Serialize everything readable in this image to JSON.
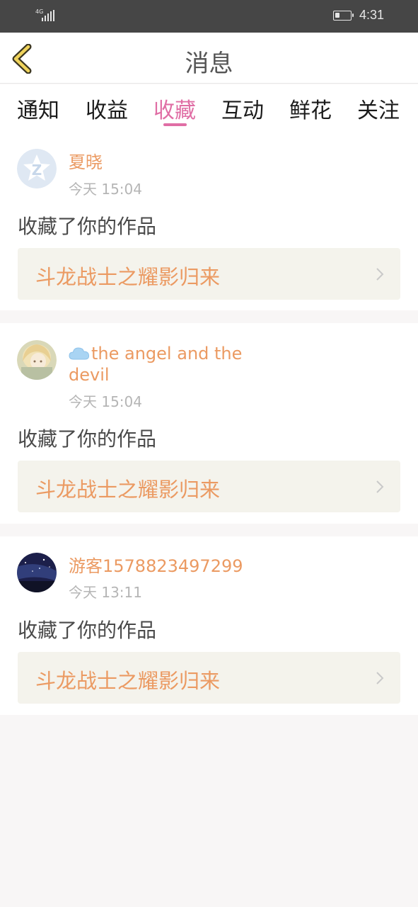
{
  "status_bar": {
    "network": "4G",
    "time": "4:31",
    "battery_level": 0.3
  },
  "nav": {
    "title": "消息",
    "back_icon": "chevron-left-icon"
  },
  "tabs": [
    {
      "label": "通知",
      "active": false
    },
    {
      "label": "收益",
      "active": false
    },
    {
      "label": "收藏",
      "active": true
    },
    {
      "label": "互动",
      "active": false
    },
    {
      "label": "鲜花",
      "active": false
    },
    {
      "label": "关注",
      "active": false
    }
  ],
  "messages": [
    {
      "username": "夏晓",
      "time": "今天 15:04",
      "action": "收藏了你的作品",
      "work_title": "斗龙战士之耀影归来",
      "avatar": "default-star-avatar"
    },
    {
      "username_line1": "the angel and the",
      "username_line2": "devil",
      "username_icon": "cloud-icon",
      "time": "今天 15:04",
      "action": "收藏了你的作品",
      "work_title": "斗龙战士之耀影归来",
      "avatar": "anime-girl-avatar"
    },
    {
      "username": "游客1578823497299",
      "time": "今天 13:11",
      "action": "收藏了你的作品",
      "work_title": "斗龙战士之耀影归来",
      "avatar": "night-sky-avatar"
    }
  ],
  "colors": {
    "accent": "#e06ea5",
    "username": "#eb9a62",
    "work_bg": "#f4f3ec",
    "status_bg": "#464646"
  }
}
